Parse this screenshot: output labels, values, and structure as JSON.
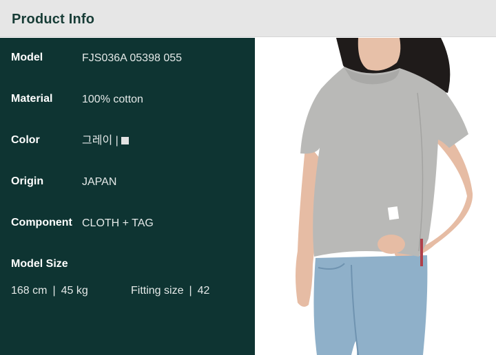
{
  "header": {
    "title": "Product Info"
  },
  "info": {
    "model_label": "Model",
    "model_value": "FJS036A 05398 055",
    "material_label": "Material",
    "material_value": "100% cotton",
    "color_label": "Color",
    "color_value": "그레이 |",
    "color_swatch": "#e3e3e3",
    "origin_label": "Origin",
    "origin_value": "JAPAN",
    "component_label": "Component",
    "component_value": "CLOTH + TAG",
    "model_size_label": "Model Size",
    "height": "168 cm",
    "weight": "45 kg",
    "fitting_label": "Fitting size",
    "fitting_value": "42",
    "divider": "|"
  },
  "colors": {
    "header_bg": "#e6e6e6",
    "header_text": "#173c36",
    "panel_bg": "#0e3432",
    "shirt": "#b9b9b7",
    "jeans": "#8fb0c9"
  }
}
